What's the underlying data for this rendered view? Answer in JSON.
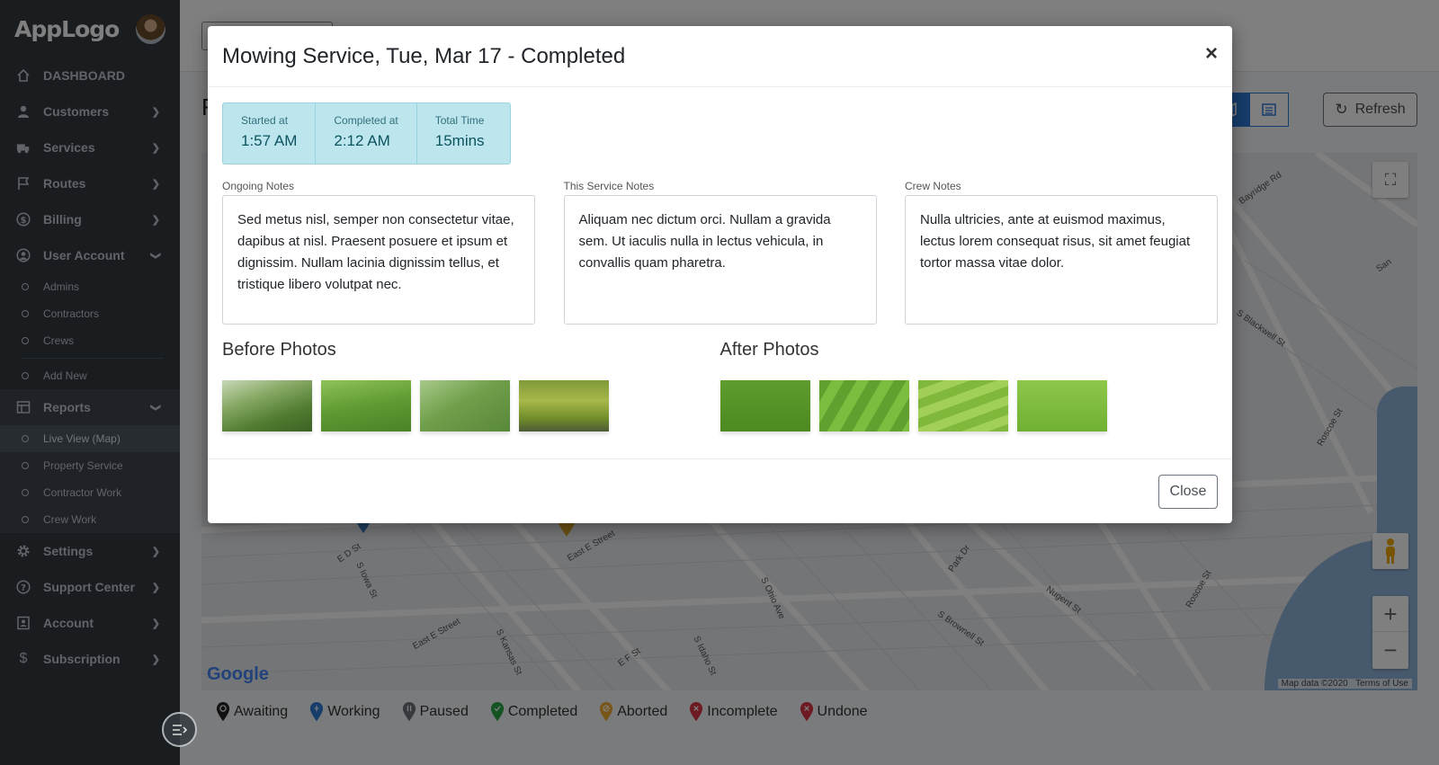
{
  "app": {
    "logo": "AppLogo"
  },
  "sidebar": {
    "items": [
      {
        "label": "DASHBOARD",
        "icon": "home-icon"
      },
      {
        "label": "Customers",
        "icon": "user-icon"
      },
      {
        "label": "Services",
        "icon": "truck-icon"
      },
      {
        "label": "Routes",
        "icon": "flag-icon"
      },
      {
        "label": "Billing",
        "icon": "dollar-circle-icon"
      },
      {
        "label": "User Account",
        "icon": "user-circle-icon"
      }
    ],
    "user_account_sub": [
      "Admins",
      "Contractors",
      "Crews"
    ],
    "add_new": "Add New",
    "reports": {
      "label": "Reports",
      "icon": "table-icon"
    },
    "reports_sub": [
      "Live View (Map)",
      "Property Service",
      "Contractor Work",
      "Crew Work"
    ],
    "bottom_items": [
      {
        "label": "Settings",
        "icon": "gear-icon"
      },
      {
        "label": "Support Center",
        "icon": "question-circle-icon"
      },
      {
        "label": "Account",
        "icon": "id-card-icon"
      },
      {
        "label": "Subscription",
        "icon": "dollar-icon"
      }
    ]
  },
  "main": {
    "page_title_initial": "F",
    "refresh_label": "Refresh",
    "map": {
      "streets": [
        "Bayridge Rd",
        "S Blackwell St",
        "Roscoe St",
        "E D St",
        "S Iowa St",
        "East E Street",
        "Park Dr",
        "Nugent St",
        "S Brownell St",
        "Roscoe St",
        "S Ohio Ave",
        "East E Street",
        "S Kansas St",
        "E F St",
        "S Idaho St",
        "San"
      ],
      "attribution": "Map data ©2020",
      "terms": "Terms of Use",
      "google": "Google"
    },
    "legend": [
      {
        "label": "Awaiting",
        "color": "#222222"
      },
      {
        "label": "Working",
        "color": "#2f7bd9"
      },
      {
        "label": "Paused",
        "color": "#6c757d"
      },
      {
        "label": "Completed",
        "color": "#28a745"
      },
      {
        "label": "Aborted",
        "color": "#f0ad2e"
      },
      {
        "label": "Incomplete",
        "color": "#dc3545"
      },
      {
        "label": "Undone",
        "color": "#dc3545"
      }
    ]
  },
  "modal": {
    "title": "Mowing Service, Tue, Mar 17 - Completed",
    "times": [
      {
        "label": "Started at",
        "value": "1:57 AM"
      },
      {
        "label": "Completed at",
        "value": "2:12 AM"
      },
      {
        "label": "Total Time",
        "value": "15mins"
      }
    ],
    "notes": [
      {
        "label": "Ongoing Notes",
        "text": "Sed metus nisl, semper non consectetur vitae, dapibus at nisl. Praesent posuere et ipsum et dignissim. Nullam lacinia dignissim tellus, et tristique libero volutpat nec."
      },
      {
        "label": "This Service Notes",
        "text": "Aliquam nec dictum orci. Nullam a gravida sem. Ut iaculis nulla in lectus vehicula, in convallis quam pharetra."
      },
      {
        "label": "Crew Notes",
        "text": "Nulla ultricies, ante at euismod maximus, lectus lorem consequat risus, sit amet feugiat tortor massa vitae dolor."
      }
    ],
    "before_photos_label": "Before Photos",
    "after_photos_label": "After Photos",
    "close_label": "Close"
  }
}
